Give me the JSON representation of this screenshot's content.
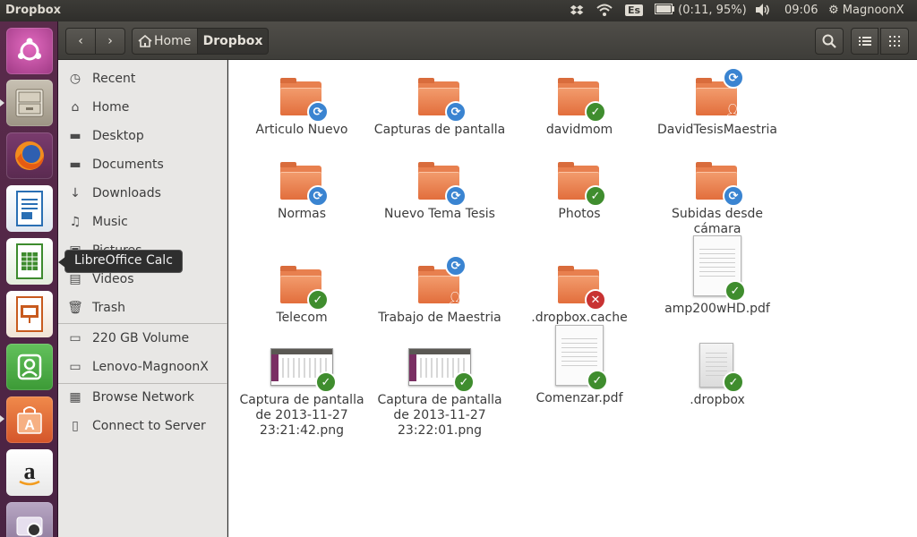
{
  "window_title": "Dropbox",
  "panel": {
    "language": "Es",
    "battery": "(0:11, 95%)",
    "time": "09:06",
    "user": "MagnoonX"
  },
  "tooltip": "LibreOffice Calc",
  "toolbar": {
    "home_label": "Home",
    "current_label": "Dropbox"
  },
  "sidebar": {
    "places": [
      "Recent",
      "Home",
      "Desktop",
      "Documents",
      "Downloads",
      "Music",
      "Pictures",
      "Videos",
      "Trash"
    ],
    "devices": [
      "220 GB Volume",
      "Lenovo-MagnoonX"
    ],
    "network": [
      "Browse Network",
      "Connect to Server"
    ]
  },
  "files": [
    {
      "name": "Articulo Nuevo",
      "kind": "folder",
      "status": "sync"
    },
    {
      "name": "Capturas de pantalla",
      "kind": "folder",
      "status": "sync"
    },
    {
      "name": "davidmom",
      "kind": "folder",
      "status": "ok"
    },
    {
      "name": "DavidTesisMaestria",
      "kind": "folder",
      "status": "sync-shared"
    },
    {
      "name": "Normas",
      "kind": "folder",
      "status": "sync"
    },
    {
      "name": "Nuevo Tema Tesis",
      "kind": "folder",
      "status": "sync"
    },
    {
      "name": "Photos",
      "kind": "folder",
      "status": "ok"
    },
    {
      "name": "Subidas desde cámara",
      "kind": "folder",
      "status": "sync"
    },
    {
      "name": "Telecom",
      "kind": "folder",
      "status": "ok"
    },
    {
      "name": "Trabajo de Maestria",
      "kind": "folder",
      "status": "sync-shared"
    },
    {
      "name": ".dropbox.cache",
      "kind": "folder",
      "status": "error"
    },
    {
      "name": "amp200wHD.pdf",
      "kind": "pdf",
      "status": "ok"
    },
    {
      "name": "Captura de pantalla de 2013-11-27 23:21:42.png",
      "kind": "image",
      "status": "ok"
    },
    {
      "name": "Captura de pantalla de 2013-11-27 23:22:01.png",
      "kind": "image",
      "status": "ok"
    },
    {
      "name": "Comenzar.pdf",
      "kind": "pdf",
      "status": "ok"
    },
    {
      "name": ".dropbox",
      "kind": "file",
      "status": "ok"
    }
  ]
}
